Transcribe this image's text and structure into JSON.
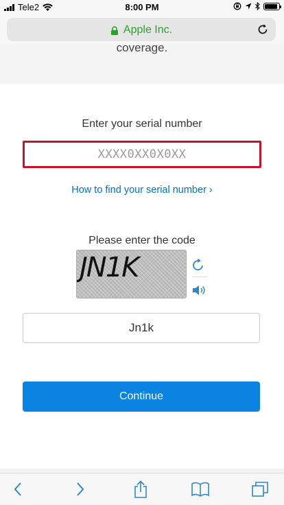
{
  "status_bar": {
    "carrier": "Tele2",
    "time": "8:00 PM",
    "icons": [
      "signal-icon",
      "wifi-icon",
      "orientation-lock-icon",
      "location-icon",
      "bluetooth-icon",
      "battery-icon"
    ]
  },
  "url_bar": {
    "site": "Apple Inc.",
    "secure_color": "#2ca02c",
    "reload_icon": "reload-icon"
  },
  "top_section": {
    "coverage_text": "coverage."
  },
  "serial": {
    "label": "Enter your serial number",
    "placeholder": "XXXX0XX0X0XX",
    "value": "",
    "border_color": "#c3132d",
    "help_link": "How to find your serial number ›"
  },
  "captcha": {
    "label": "Please enter the code",
    "image_text": "JN1K",
    "refresh_icon": "refresh-icon",
    "audio_icon": "speaker-icon",
    "input_value": "Jn1k"
  },
  "actions": {
    "continue_label": "Continue",
    "accent_color": "#0a84e0"
  },
  "toolbar": {
    "items": [
      "back-icon",
      "forward-icon",
      "share-icon",
      "bookmarks-icon",
      "tabs-icon"
    ]
  }
}
